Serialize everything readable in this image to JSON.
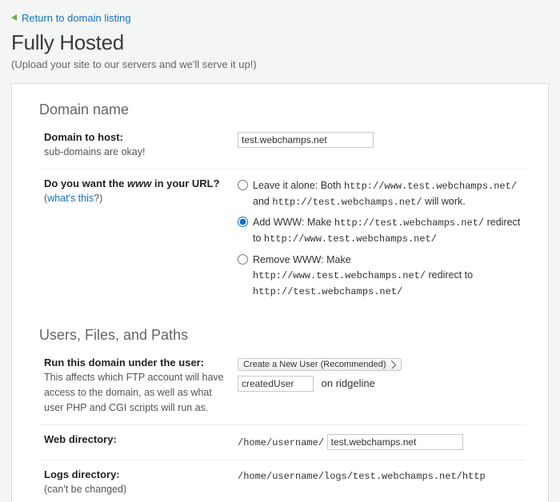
{
  "return_link_label": "Return to domain listing",
  "page_title": "Fully Hosted",
  "page_subtitle": "(Upload your site to our servers and we'll serve it up!)",
  "domain_section": {
    "title": "Domain name",
    "domain_to_host_label": "Domain to host:",
    "domain_to_host_hint": "sub-domains are okay!",
    "domain_to_host_value": "test.webchamps.net",
    "www_question_prefix": "Do you want the ",
    "www_question_italic": "www",
    "www_question_suffix": " in your URL?",
    "whats_this_paren_open": "(",
    "whats_this_label": "what's this",
    "whats_this_paren_close": "?)",
    "www_options": {
      "leave": {
        "label_prefix": "Leave it alone: Both ",
        "url1": "http://www.test.webchamps.net/",
        "middle": " and ",
        "url2": "http://test.webchamps.net/",
        "suffix": " will work.",
        "selected": false
      },
      "add": {
        "label_prefix": "Add WWW: Make ",
        "url1": "http://test.webchamps.net/",
        "middle": " redirect to ",
        "url2": "http://www.test.webchamps.net/",
        "selected": true
      },
      "remove": {
        "label_prefix": "Remove WWW: Make ",
        "url1": "http://www.test.webchamps.net/",
        "middle": " redirect to ",
        "url2": "http://test.webchamps.net/",
        "selected": false
      }
    }
  },
  "users_section": {
    "title": "Users, Files, and Paths",
    "run_user_label": "Run this domain under the user:",
    "run_user_hint": "This affects which FTP account will have access to the domain, as well as what user PHP and CGI scripts will run as.",
    "user_select_value": "Create a New User (Recommended)",
    "new_user_value": "createdUser",
    "on_word": "on",
    "server_name": "ridgeline",
    "web_dir_label": "Web directory:",
    "web_dir_prefix": "/home/username/",
    "web_dir_value": "test.webchamps.net",
    "logs_dir_label": "Logs directory:",
    "logs_dir_hint": "(can't be changed)",
    "logs_dir_value": "/home/username/logs/test.webchamps.net/http"
  }
}
